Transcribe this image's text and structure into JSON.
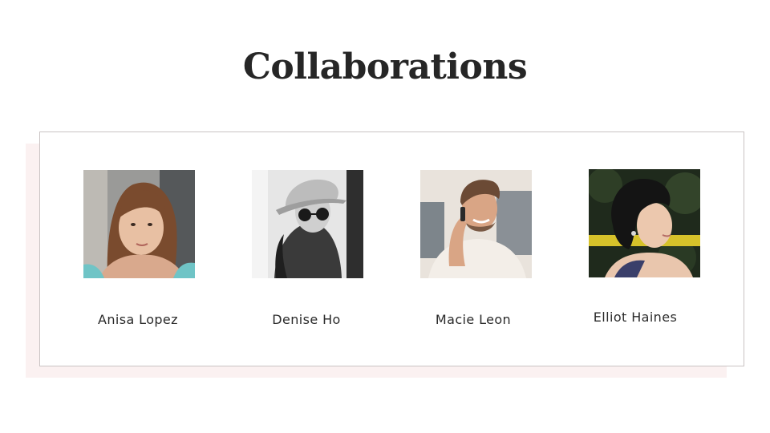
{
  "page": {
    "title": "Collaborations"
  },
  "collaborators": [
    {
      "name": "Anisa Lopez",
      "photo_icon": "portrait-woman-brown-hair"
    },
    {
      "name": "Denise Ho",
      "photo_icon": "portrait-woman-hat-sunglasses"
    },
    {
      "name": "Macie Leon",
      "photo_icon": "portrait-man-on-phone"
    },
    {
      "name": "Elliot Haines",
      "photo_icon": "portrait-woman-curly-hair"
    }
  ],
  "colors": {
    "title": "#262626",
    "card_border": "#c9c3c3",
    "card_shadow": "#fbf1f1",
    "name_text": "#2a2a2a"
  }
}
